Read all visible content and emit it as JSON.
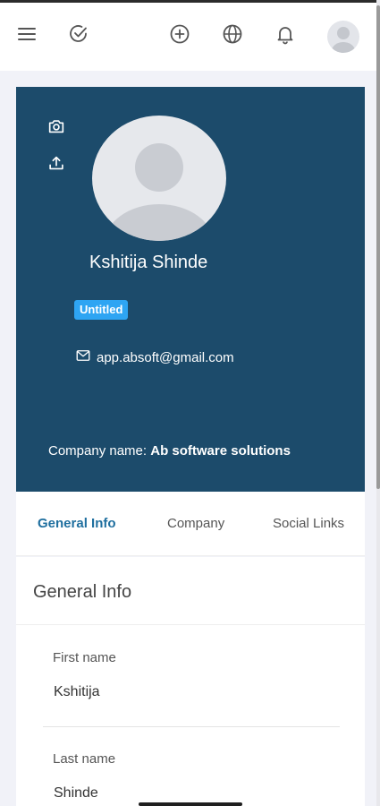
{
  "header": {
    "icons": [
      "menu-icon",
      "check-circle-icon",
      "add-circle-icon",
      "globe-icon",
      "bell-icon",
      "user-avatar"
    ]
  },
  "profile": {
    "name": "Kshitija Shinde",
    "badge": "Untitled",
    "email": "app.absoft@gmail.com",
    "company_label": "Company name:",
    "company_value": "Ab software solutions",
    "card_color": "#1c4b6b",
    "badge_color": "#2ea5f3"
  },
  "tabs": [
    {
      "label": "General Info",
      "active": true
    },
    {
      "label": "Company",
      "active": false
    },
    {
      "label": "Social Links",
      "active": false
    }
  ],
  "general_info": {
    "title": "General Info",
    "fields": [
      {
        "label": "First name",
        "value": "Kshitija"
      },
      {
        "label": "Last name",
        "value": "Shinde"
      }
    ]
  }
}
